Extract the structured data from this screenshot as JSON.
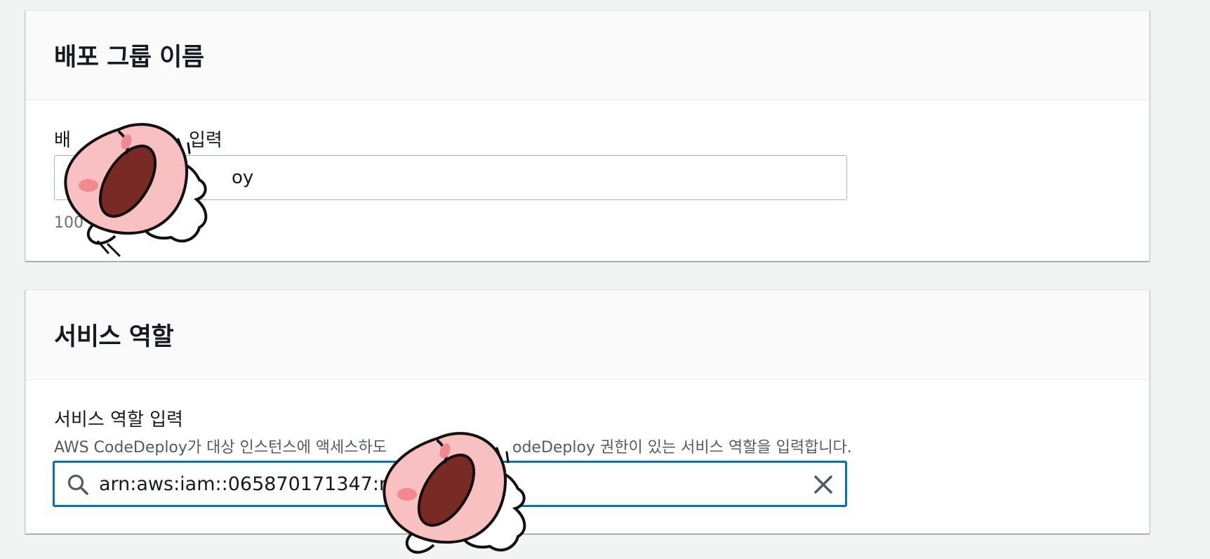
{
  "deployment_group": {
    "title": "배포 그룹 이름",
    "label_visible": "배",
    "label_tail": "입력",
    "input_value_visible": "oy",
    "constraint_visible": "100"
  },
  "service_role": {
    "title": "서비스 역할",
    "label": "서비스 역할 입력",
    "description_start": "AWS CodeDeploy가 대상 인스턴스에 액세스하도",
    "description_end": "odeDeploy 권한이 있는 서비스 역할을 입력합니다.",
    "input_value_visible": "arn:aws:iam::065870171347:rol",
    "search_icon": "search-icon",
    "clear_icon": "close-icon"
  },
  "colors": {
    "focus_border": "#0073bb",
    "page_background": "#f2f3f3",
    "sticker_skin": "#f9c0c2",
    "sticker_mouth": "#7a2a24"
  }
}
